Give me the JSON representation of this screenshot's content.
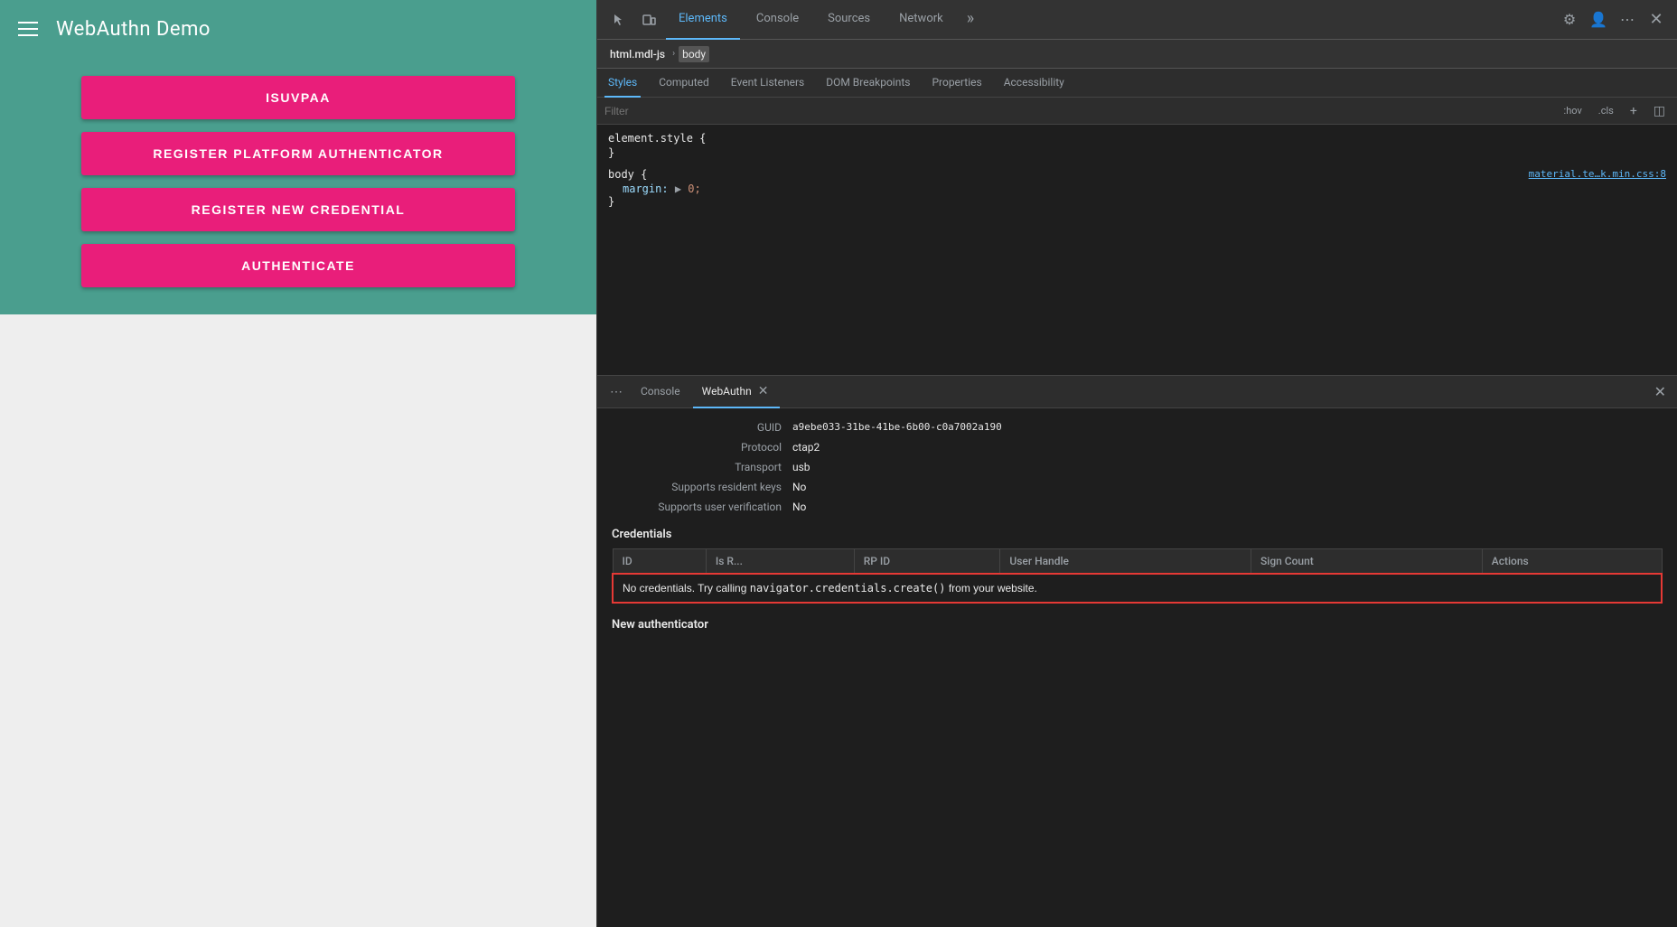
{
  "app": {
    "title": "WebAuthn Demo",
    "header_bg": "#4a9e8e",
    "buttons": [
      {
        "label": "ISUVPAA",
        "id": "isuvpaa"
      },
      {
        "label": "REGISTER PLATFORM AUTHENTICATOR",
        "id": "register-platform"
      },
      {
        "label": "REGISTER NEW CREDENTIAL",
        "id": "register-new"
      },
      {
        "label": "AUTHENTICATE",
        "id": "authenticate"
      }
    ]
  },
  "devtools": {
    "tabs": [
      {
        "label": "Elements",
        "active": true
      },
      {
        "label": "Console",
        "active": false
      },
      {
        "label": "Sources",
        "active": false
      },
      {
        "label": "Network",
        "active": false
      }
    ],
    "breadcrumb": [
      {
        "label": "html.mdl-js",
        "type": "tag"
      },
      {
        "label": "body",
        "type": "active"
      }
    ],
    "styles_tabs": [
      {
        "label": "Styles",
        "active": true
      },
      {
        "label": "Computed",
        "active": false
      },
      {
        "label": "Event Listeners",
        "active": false
      },
      {
        "label": "DOM Breakpoints",
        "active": false
      },
      {
        "label": "Properties",
        "active": false
      },
      {
        "label": "Accessibility",
        "active": false
      }
    ],
    "filter_placeholder": "Filter",
    "filter_hov": ":hov",
    "filter_cls": ".cls",
    "css_blocks": [
      {
        "selector": "element.style {",
        "close": "}",
        "source": "",
        "properties": []
      },
      {
        "selector": "body {",
        "close": "}",
        "source": "material.te…k.min.css:8",
        "properties": [
          {
            "name": "margin:",
            "value": "▶ 0;"
          }
        ]
      }
    ]
  },
  "webauthn": {
    "panel_tabs": [
      {
        "label": "...",
        "id": "dots"
      },
      {
        "label": "Console",
        "id": "console",
        "active": false
      },
      {
        "label": "WebAuthn",
        "id": "webauthn",
        "active": true
      }
    ],
    "device_info": [
      {
        "label": "GUID",
        "value": "a9ebe033-31be-41be-6b00-c0a7002a190"
      },
      {
        "label": "Protocol",
        "value": "ctap2"
      },
      {
        "label": "Transport",
        "value": "usb"
      },
      {
        "label": "Supports resident keys",
        "value": "No"
      },
      {
        "label": "Supports user verification",
        "value": "No"
      }
    ],
    "credentials_title": "Credentials",
    "credentials_columns": [
      "ID",
      "Is R...",
      "RP ID",
      "User Handle",
      "Sign Count",
      "Actions"
    ],
    "no_credentials_text": "No credentials. Try calling ",
    "no_credentials_code": "navigator.credentials.create()",
    "no_credentials_suffix": " from your website.",
    "new_authenticator_title": "New authenticator"
  }
}
